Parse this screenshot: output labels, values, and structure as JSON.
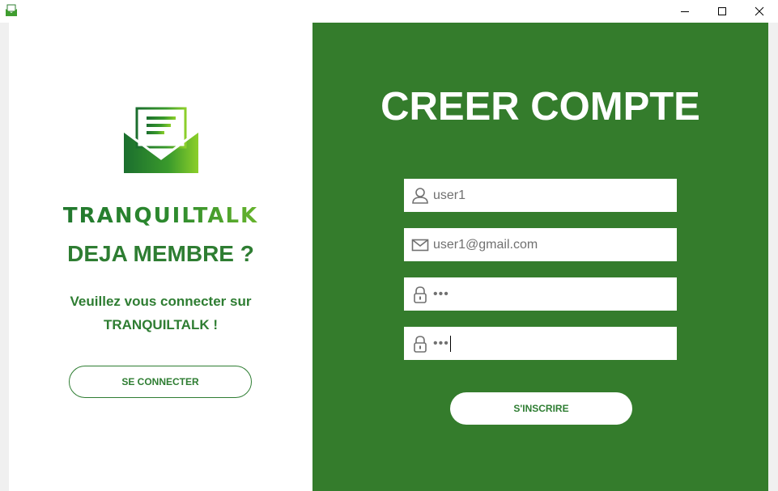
{
  "window": {
    "icons": {
      "app": "mail-app-icon",
      "minimize": "minimize-icon",
      "maximize": "maximize-icon",
      "close": "close-icon"
    }
  },
  "left": {
    "logo_icon": "envelope-letter-icon",
    "brand": "TRANQUILTALK",
    "heading": "DEJA MEMBRE ?",
    "subtext_line1": "Veuillez vous connecter sur",
    "subtext_line2": "TRANQUILTALK !",
    "connect_label": "SE CONNECTER"
  },
  "right": {
    "title": "CREER COMPTE",
    "fields": {
      "username": {
        "icon": "user-icon",
        "value": "user1"
      },
      "email": {
        "icon": "envelope-icon",
        "value": "user1@gmail.com"
      },
      "password": {
        "icon": "lock-icon",
        "value": "•••"
      },
      "confirm_password": {
        "icon": "lock-icon",
        "value": "•••"
      }
    },
    "signup_label": "S'INSCRIRE"
  },
  "colors": {
    "accent": "#347c2c",
    "text_green": "#2e7d32",
    "lime": "#8ccf2a"
  }
}
